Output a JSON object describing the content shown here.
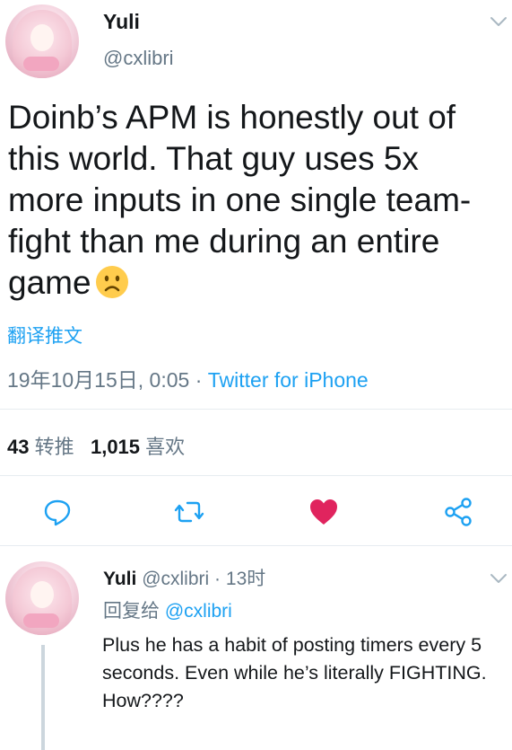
{
  "tweet": {
    "author": {
      "display_name": "Yuli",
      "handle": "@cxlibri"
    },
    "text": "Doinb’s APM is honestly out of this world. That guy uses 5x more inputs in one single team-fight than me during an entire game",
    "emoji": "frowning-face-emoji",
    "translate_label": "翻译推文",
    "timestamp": "19年10月15日, 0:05",
    "separator": "·",
    "source": "Twitter for iPhone",
    "stats": {
      "retweets_count": "43",
      "retweets_label": "转推",
      "likes_count": "1,015",
      "likes_label": "喜欢"
    },
    "actions": {
      "reply_icon": "reply-icon",
      "retweet_icon": "retweet-icon",
      "like_icon": "heart-icon",
      "share_icon": "share-icon",
      "liked": true,
      "like_color": "#e0245e"
    }
  },
  "reply": {
    "author": {
      "display_name": "Yuli",
      "handle": "@cxlibri"
    },
    "separator": "·",
    "time": "13时",
    "replying_to_label": "回复给",
    "replying_to_handle": "@cxlibri",
    "text": "Plus he has a habit of posting timers every 5 seconds. Even while he’s literally FIGHTING. How????"
  },
  "colors": {
    "accent": "#1da1f2",
    "secondary_text": "#657786",
    "primary_text": "#14171a",
    "divider": "#e6ecf0",
    "like_red": "#e0245e"
  }
}
